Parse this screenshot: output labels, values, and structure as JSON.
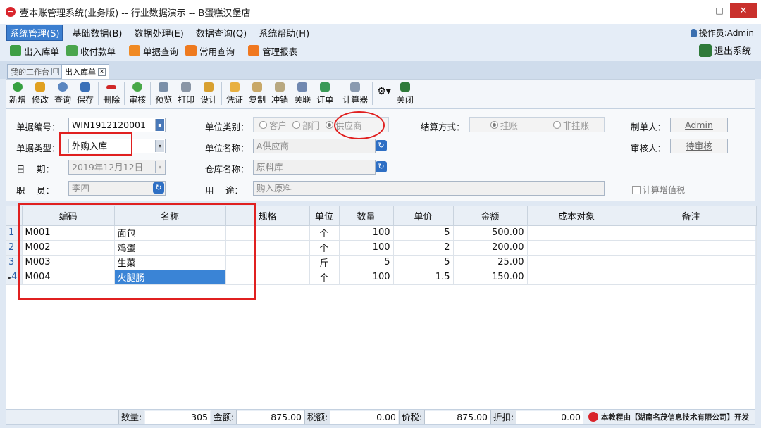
{
  "window": {
    "title": "壹本账管理系统(业务版) -- 行业数据演示 -- B蛋糕汉堡店",
    "minimize": "–",
    "maximize": "□",
    "close": "✕"
  },
  "menu": [
    "系统管理(S)",
    "基础数据(B)",
    "数据处理(E)",
    "数据查询(Q)",
    "系统帮助(H)"
  ],
  "operator": "操作员:Admin",
  "toolbar1": [
    "出入库单",
    "收付款单",
    "单据查询",
    "常用查询",
    "管理报表"
  ],
  "exit_label": "退出系统",
  "tabs": [
    "我的工作台",
    "出入库单"
  ],
  "toolbar2": [
    "新增",
    "修改",
    "查询",
    "保存",
    "删除",
    "审核",
    "预览",
    "打印",
    "设计",
    "凭证",
    "复制",
    "冲销",
    "关联",
    "订单",
    "计算器",
    "关闭"
  ],
  "form": {
    "doc_no_label": "单据编号：",
    "doc_no": "WIN1912120001",
    "doc_type_label": "单据类型：",
    "doc_type": "外购入库",
    "date_label": "日　 期：",
    "date": "2019年12月12日",
    "staff_label": "职　 员：",
    "staff": "李四",
    "unit_cat_label": "单位类别：",
    "unit_cat_options": [
      "客户",
      "部门",
      "供应商"
    ],
    "unit_name_label": "单位名称：",
    "unit_name": "A供应商",
    "warehouse_label": "仓库名称：",
    "warehouse": "原料库",
    "purpose_label": "用　 途：",
    "purpose": "购入原料",
    "settle_label": "结算方式：",
    "settle_options": [
      "挂账",
      "非挂账"
    ],
    "maker_label": "制单人：",
    "maker": "Admin",
    "auditor_label": "审核人：",
    "auditor": "待审核",
    "vat_label": "计算增值税"
  },
  "table": {
    "headers": [
      "编码",
      "名称",
      "规格",
      "单位",
      "数量",
      "单价",
      "金额",
      "成本对象",
      "备注"
    ],
    "rows": [
      {
        "n": "1",
        "code": "M001",
        "name": "面包",
        "spec": "",
        "unit": "个",
        "qty": "100",
        "price": "5",
        "amount": "500.00",
        "cost": "",
        "note": ""
      },
      {
        "n": "2",
        "code": "M002",
        "name": "鸡蛋",
        "spec": "",
        "unit": "个",
        "qty": "100",
        "price": "2",
        "amount": "200.00",
        "cost": "",
        "note": ""
      },
      {
        "n": "3",
        "code": "M003",
        "name": "生菜",
        "spec": "",
        "unit": "斤",
        "qty": "5",
        "price": "5",
        "amount": "25.00",
        "cost": "",
        "note": ""
      },
      {
        "n": "4",
        "code": "M004",
        "name": "火腿肠",
        "spec": "",
        "unit": "个",
        "qty": "100",
        "price": "1.5",
        "amount": "150.00",
        "cost": "",
        "note": ""
      }
    ]
  },
  "summary": {
    "qty_label": "数量:",
    "qty": "305",
    "amount_label": "金额:",
    "amount": "875.00",
    "tax_label": "税额:",
    "tax": "0.00",
    "total_label": "价税:",
    "total": "875.00",
    "discount_label": "折扣:",
    "discount": "0.00"
  },
  "footer_credit": "本教程由【湖南名茂信息技术有限公司】开发"
}
